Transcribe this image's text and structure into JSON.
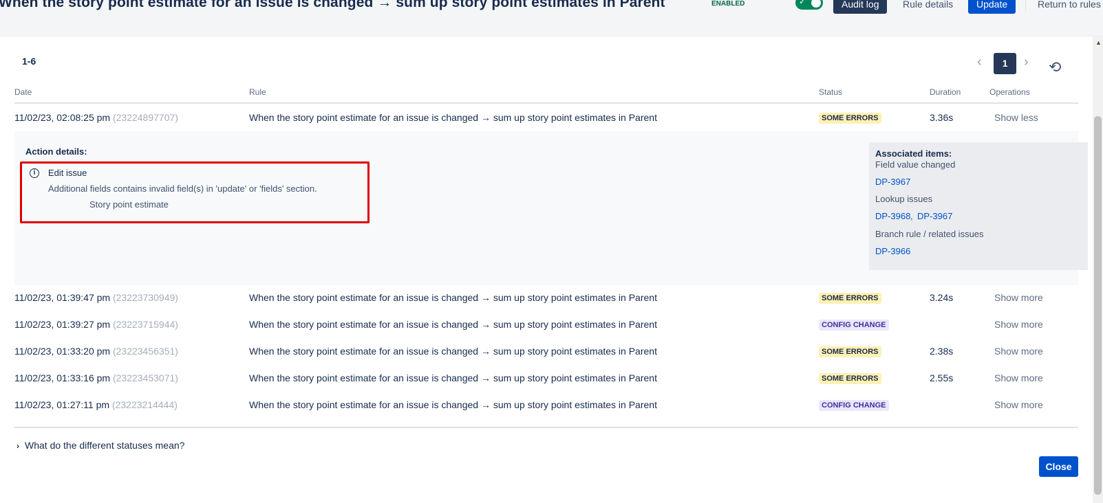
{
  "header": {
    "rule_title": "When the story point estimate for an issue is changed → sum up story point estimates in Parent",
    "enabled_label": "ENABLED",
    "toggle_on": true,
    "audit_log_label": "Audit log",
    "rule_details_label": "Rule details",
    "update_label": "Update",
    "return_label": "Return to rules"
  },
  "audit": {
    "count_label": "1-6",
    "current_page": "1",
    "columns": {
      "date": "Date",
      "rule": "Rule",
      "status": "Status",
      "duration": "Duration",
      "operations": "Operations"
    },
    "rows": [
      {
        "date": "11/02/23, 02:08:25 pm",
        "id": "(23224897707)",
        "rule": "When the story point estimate for an issue is changed → sum up story point estimates in Parent",
        "status": "SOME ERRORS",
        "duration": "3.36s",
        "operation": "Show less"
      },
      {
        "date": "11/02/23, 01:39:47 pm",
        "id": "(23223730949)",
        "rule": "When the story point estimate for an issue is changed → sum up story point estimates in Parent",
        "status": "SOME ERRORS",
        "duration": "3.24s",
        "operation": "Show more"
      },
      {
        "date": "11/02/23, 01:39:27 pm",
        "id": "(23223715944)",
        "rule": "When the story point estimate for an issue is changed → sum up story point estimates in Parent",
        "status": "CONFIG CHANGE",
        "duration": "",
        "operation": "Show more"
      },
      {
        "date": "11/02/23, 01:33:20 pm",
        "id": "(23223456351)",
        "rule": "When the story point estimate for an issue is changed → sum up story point estimates in Parent",
        "status": "SOME ERRORS",
        "duration": "2.38s",
        "operation": "Show more"
      },
      {
        "date": "11/02/23, 01:33:16 pm",
        "id": "(23223453071)",
        "rule": "When the story point estimate for an issue is changed → sum up story point estimates in Parent",
        "status": "SOME ERRORS",
        "duration": "2.55s",
        "operation": "Show more"
      },
      {
        "date": "11/02/23, 01:27:11 pm",
        "id": "(23223214444)",
        "rule": "When the story point estimate for an issue is changed → sum up story point estimates in Parent",
        "status": "CONFIG CHANGE",
        "duration": "",
        "operation": "Show more"
      }
    ],
    "details": {
      "action_label": "Action details:",
      "action_name": "Edit issue",
      "error_message": "Additional fields contains invalid field(s) in 'update' or 'fields' section.",
      "error_field": "Story point estimate",
      "associated_title": "Associated items:",
      "field_value_changed_label": "Field value changed",
      "field_value_changed_issues": [
        "DP-3967"
      ],
      "lookup_label": "Lookup issues",
      "lookup_issues": [
        "DP-3968",
        "DP-3967"
      ],
      "branch_label": "Branch rule / related issues",
      "branch_issues": [
        "DP-3966"
      ]
    },
    "statuses_help": "What do the different statuses mean?",
    "close_label": "Close"
  },
  "colors": {
    "primary": "#0052cc",
    "dark_button": "#253858",
    "error_highlight": "#e00000",
    "toggle_green": "#00875a",
    "some_errors_bg": "#fff0b3",
    "config_change_bg": "#eae6ff"
  },
  "icons": [
    "info-icon",
    "chevron-left-icon",
    "chevron-right-icon",
    "refresh-icon",
    "chevron-right-icon",
    "check-icon"
  ]
}
